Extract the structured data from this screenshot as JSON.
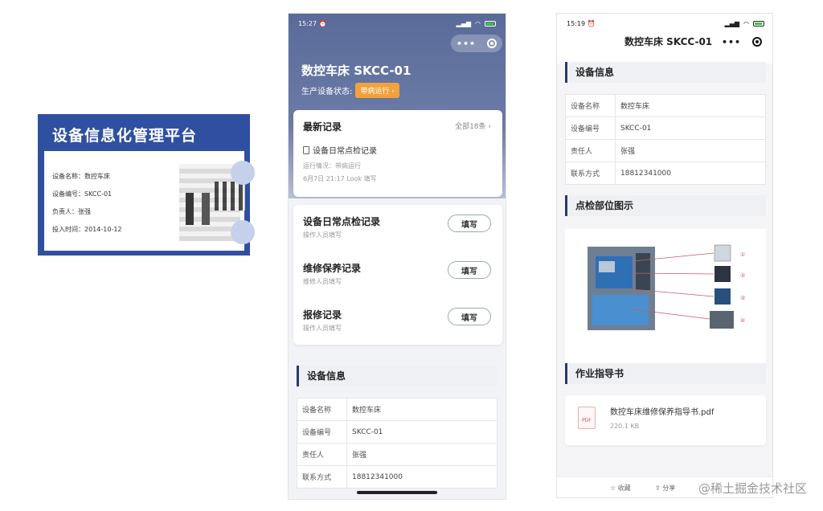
{
  "card": {
    "title": "设备信息化管理平台",
    "rows": [
      {
        "label": "设备名称：",
        "value": "数控车床"
      },
      {
        "label": "设备编号：",
        "value": "SKCC-01"
      },
      {
        "label": "负责人：",
        "value": "张强"
      },
      {
        "label": "投入时间：",
        "value": "2014-10-12"
      }
    ]
  },
  "phone1": {
    "time": "15:27",
    "title": "数控车床 SKCC-01",
    "status_label": "生产设备状态:",
    "status_value": "带病运行",
    "status_arrow": "›",
    "latest": {
      "heading": "最新记录",
      "all_link": "全部18条 ›",
      "record_name": "设备日常点检记录",
      "run_status": "运行情况：带病运行",
      "meta": "6月7日 21:17 Look 填写"
    },
    "forms": [
      {
        "title": "设备日常点检记录",
        "sub": "操作人员填写",
        "button": "填写"
      },
      {
        "title": "维修保养记录",
        "sub": "维修人员填写",
        "button": "填写"
      },
      {
        "title": "报修记录",
        "sub": "操作人员填写",
        "button": "填写"
      }
    ],
    "info_heading": "设备信息",
    "info": [
      {
        "k": "设备名称",
        "v": "数控车床"
      },
      {
        "k": "设备编号",
        "v": "SKCC-01"
      },
      {
        "k": "责任人",
        "v": "张强"
      },
      {
        "k": "联系方式",
        "v": "18812341000"
      }
    ]
  },
  "phone2": {
    "time": "15:19",
    "title": "数控车床 SKCC-01",
    "info_heading": "设备信息",
    "info": [
      {
        "k": "设备名称",
        "v": "数控车床"
      },
      {
        "k": "设备编号",
        "v": "SKCC-01"
      },
      {
        "k": "责任人",
        "v": "张强"
      },
      {
        "k": "联系方式",
        "v": "18812341000"
      }
    ],
    "diagram_heading": "点检部位图示",
    "diagram_marks": [
      "①",
      "②",
      "③",
      "④"
    ],
    "guide_heading": "作业指导书",
    "pdf": {
      "icon_text": "PDF",
      "name": "数控车床维修保养指导书.pdf",
      "size": "220.1 KB"
    },
    "bottom": {
      "collect": "☆ 收藏",
      "share": "⇪ 分享"
    }
  },
  "watermark": "@稀土掘金技术社区",
  "colors": {
    "card_blue": "#2f4fa0",
    "header_blue": "#5a6b9a",
    "accent_orange": "#f2a23a",
    "section_bar": "#2b3a67"
  }
}
